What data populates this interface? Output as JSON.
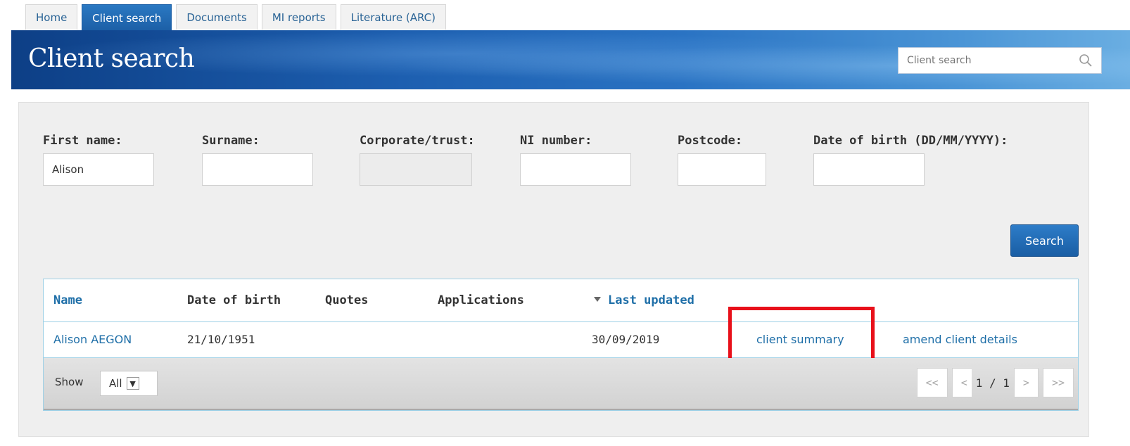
{
  "tabs": [
    {
      "label": "Home",
      "active": false
    },
    {
      "label": "Client search",
      "active": true
    },
    {
      "label": "Documents",
      "active": false
    },
    {
      "label": "MI reports",
      "active": false
    },
    {
      "label": "Literature (ARC)",
      "active": false
    }
  ],
  "banner": {
    "title": "Client search",
    "search_placeholder": "Client search",
    "search_icon": "magnifier-icon"
  },
  "form": {
    "first_name": {
      "label": "First name:",
      "value": "Alison"
    },
    "surname": {
      "label": "Surname:",
      "value": ""
    },
    "corporate_trust": {
      "label": "Corporate/trust:",
      "value": ""
    },
    "ni_number": {
      "label": "NI number:",
      "value": ""
    },
    "postcode": {
      "label": "Postcode:",
      "value": ""
    },
    "dob": {
      "label": "Date of birth (DD/MM/YYYY):",
      "value": ""
    },
    "search_button": "Search"
  },
  "results": {
    "headers": {
      "name": "Name",
      "dob": "Date of birth",
      "quotes": "Quotes",
      "applications": "Applications",
      "last_updated": "Last updated"
    },
    "rows": [
      {
        "name": "Alison AEGON",
        "dob": "21/10/1951",
        "quotes": "",
        "applications": "",
        "last_updated": "30/09/2019",
        "summary_link": "client summary",
        "amend_link": "amend client details"
      }
    ],
    "footer": {
      "show_label": "Show",
      "show_value": "All",
      "first": "<<",
      "prev": "<",
      "page": "1 / 1",
      "next": ">",
      "last": ">>"
    }
  },
  "colors": {
    "accent": "#1f6fa8",
    "tab_active": "#1c5fa6",
    "highlight": "#e8101a",
    "table_border": "#9dd0e6"
  }
}
